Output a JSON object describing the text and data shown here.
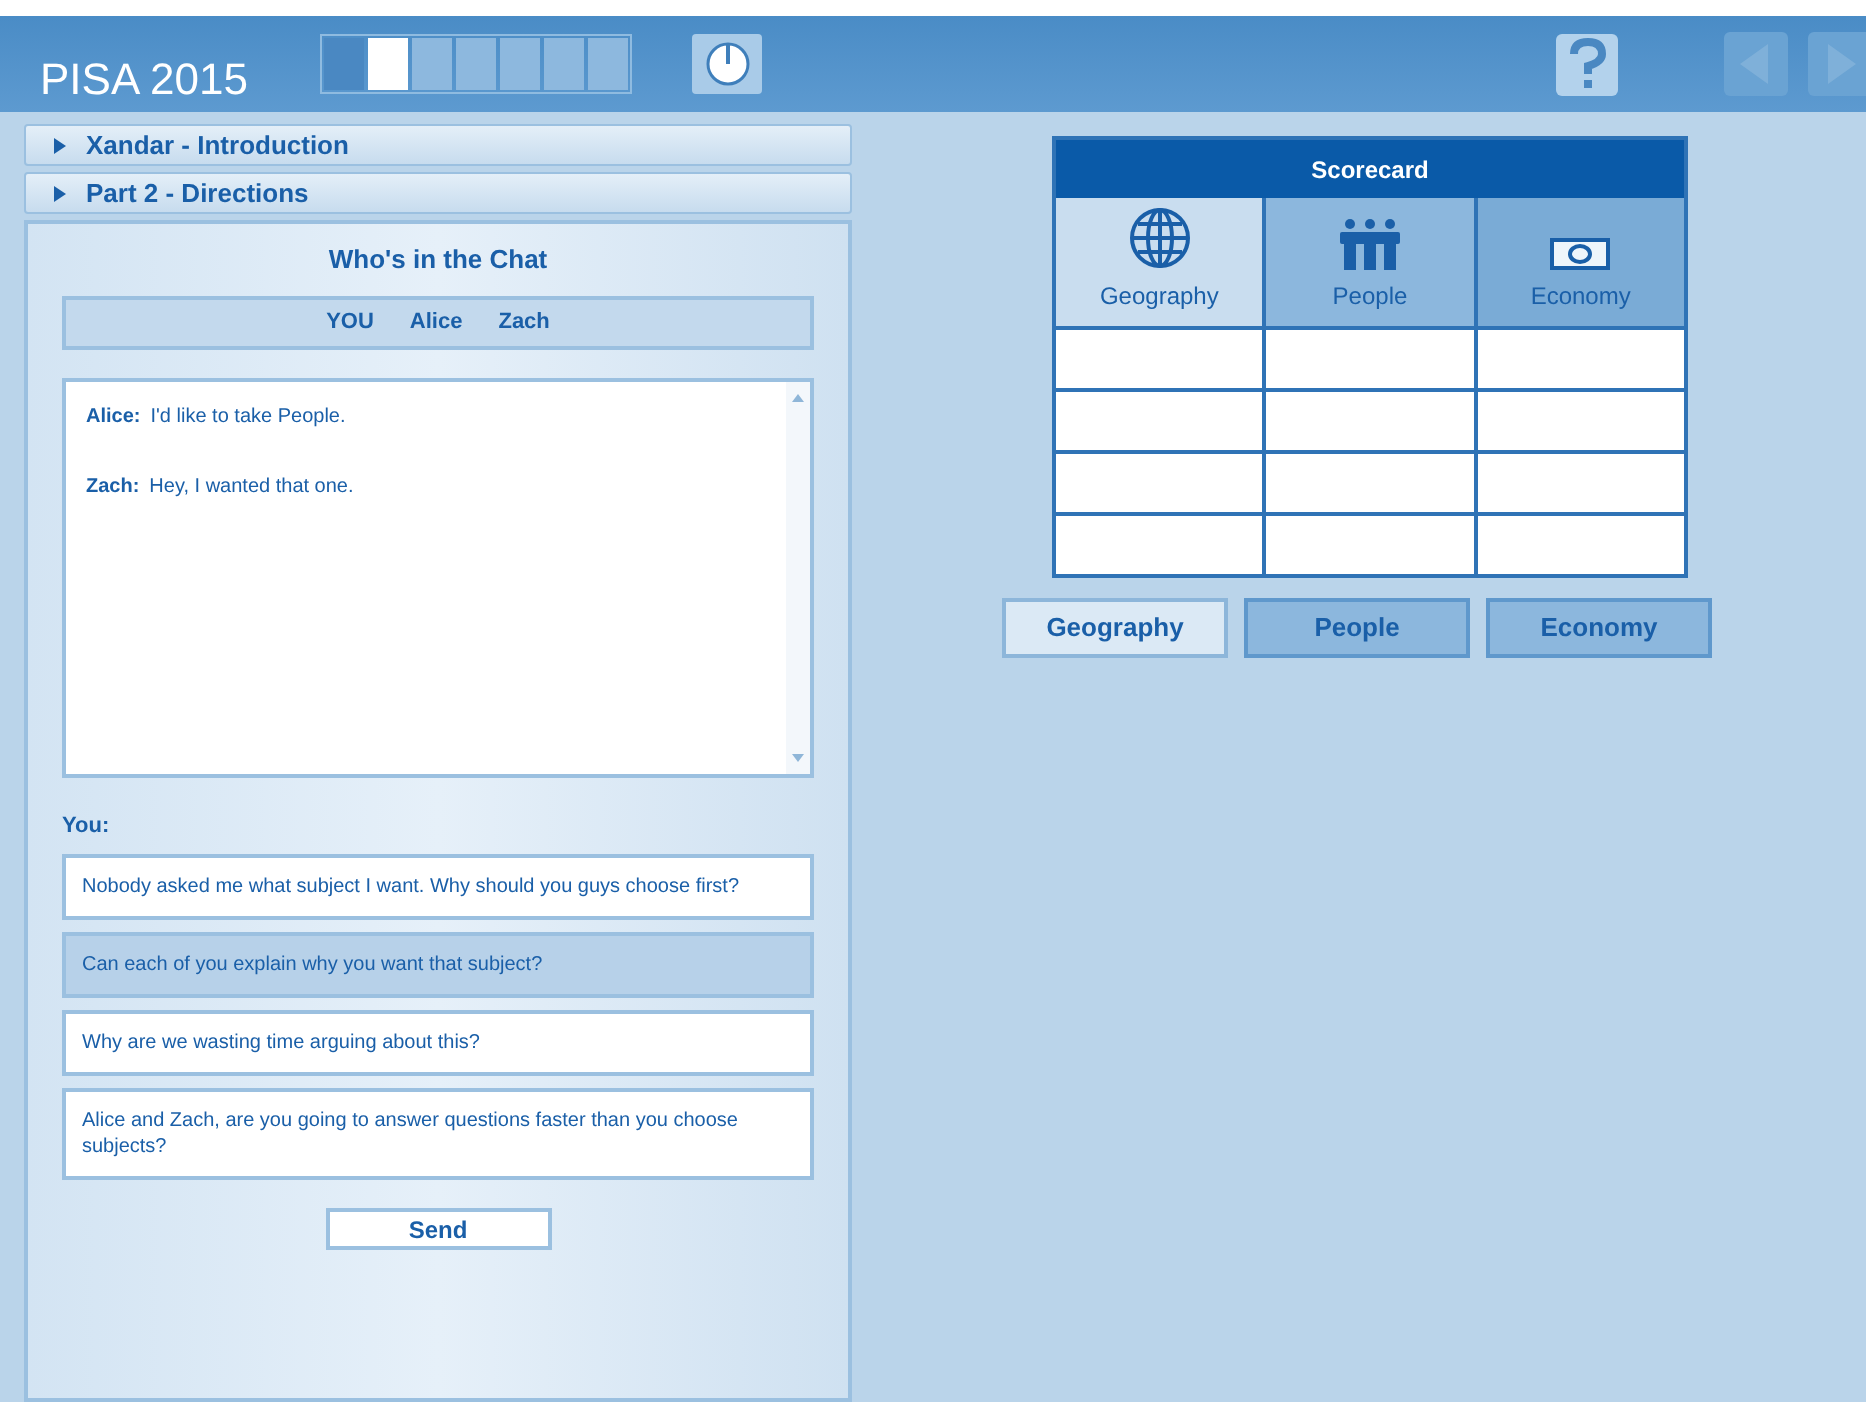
{
  "header": {
    "title": "PISA 2015",
    "progress": [
      {
        "kind": "done"
      },
      {
        "kind": "current"
      },
      {
        "kind": "todo"
      },
      {
        "kind": "todo"
      },
      {
        "kind": "todo"
      },
      {
        "kind": "todo"
      },
      {
        "kind": "todo"
      }
    ],
    "nav": [
      {
        "kind": "back",
        "disabled": true
      },
      {
        "kind": "forward",
        "disabled": true
      }
    ]
  },
  "sections": [
    {
      "label": "Xandar - Introduction",
      "expanded": false
    },
    {
      "label": "Part 2 - Directions",
      "expanded": false
    }
  ],
  "chat": {
    "title": "Who's in the Chat",
    "participants": [
      "YOU",
      "Alice",
      "Zach"
    ],
    "messages": [
      {
        "speaker": "Alice:",
        "text": "I'd like to take People."
      },
      {
        "speaker": "Zach:",
        "text": "Hey, I wanted that one."
      }
    ],
    "you_label": "You:",
    "responses": [
      {
        "text": "Nobody asked me what subject I want. Why should you guys choose first?",
        "selected": false
      },
      {
        "text": "Can each of you explain why you want that subject?",
        "selected": true
      },
      {
        "text": "Why are we wasting time arguing about this?",
        "selected": false
      },
      {
        "text": "Alice and Zach, are you going to answer questions faster than you choose subjects?",
        "selected": false
      }
    ],
    "send": "Send"
  },
  "scorecard": {
    "title": "Scorecard",
    "columns": [
      {
        "label": "Geography",
        "kind": "globe",
        "selected": true
      },
      {
        "label": "People",
        "kind": "people",
        "selected": false
      },
      {
        "label": "Economy",
        "kind": "money",
        "selected": false
      }
    ],
    "buttons": [
      {
        "label": "Geography",
        "selected": true
      },
      {
        "label": "People",
        "selected": false
      },
      {
        "label": "Economy",
        "selected": false
      }
    ]
  }
}
